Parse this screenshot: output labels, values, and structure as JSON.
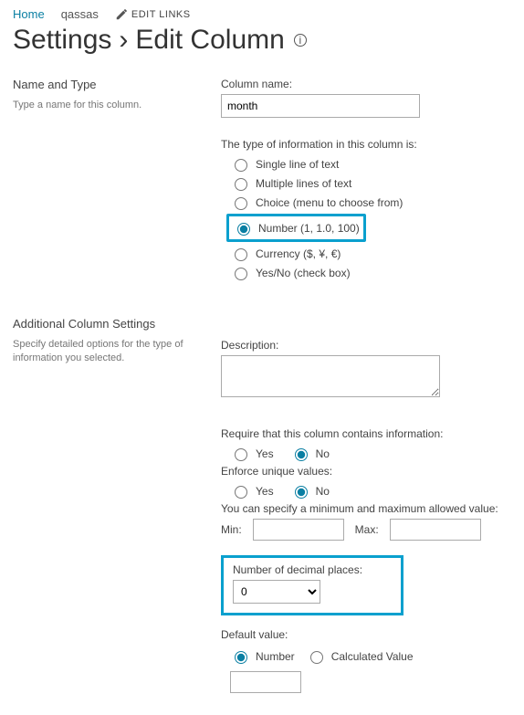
{
  "topnav": {
    "home": "Home",
    "crumb": "qassas",
    "edit_links": "EDIT LINKS"
  },
  "title": {
    "part1": "Settings",
    "part2": "Edit Column"
  },
  "section1": {
    "heading": "Name and Type",
    "help": "Type a name for this column."
  },
  "column_name": {
    "label": "Column name:",
    "value": "month"
  },
  "type_prompt": "The type of information in this column is:",
  "types": [
    "Single line of text",
    "Multiple lines of text",
    "Choice (menu to choose from)",
    "Number (1, 1.0, 100)",
    "Currency ($, ¥, €)",
    "Yes/No (check box)"
  ],
  "type_selected_index": 3,
  "section2": {
    "heading": "Additional Column Settings",
    "help": "Specify detailed options for the type of information you selected."
  },
  "description_label": "Description:",
  "require": {
    "label": "Require that this column contains information:",
    "yes": "Yes",
    "no": "No"
  },
  "unique": {
    "label": "Enforce unique values:",
    "yes": "Yes",
    "no": "No"
  },
  "minmax": {
    "label": "You can specify a minimum and maximum allowed value:",
    "min": "Min:",
    "max": "Max:"
  },
  "decimal": {
    "label": "Number of decimal places:",
    "value": "0"
  },
  "default_value": {
    "label": "Default value:",
    "number": "Number",
    "calculated": "Calculated Value"
  }
}
